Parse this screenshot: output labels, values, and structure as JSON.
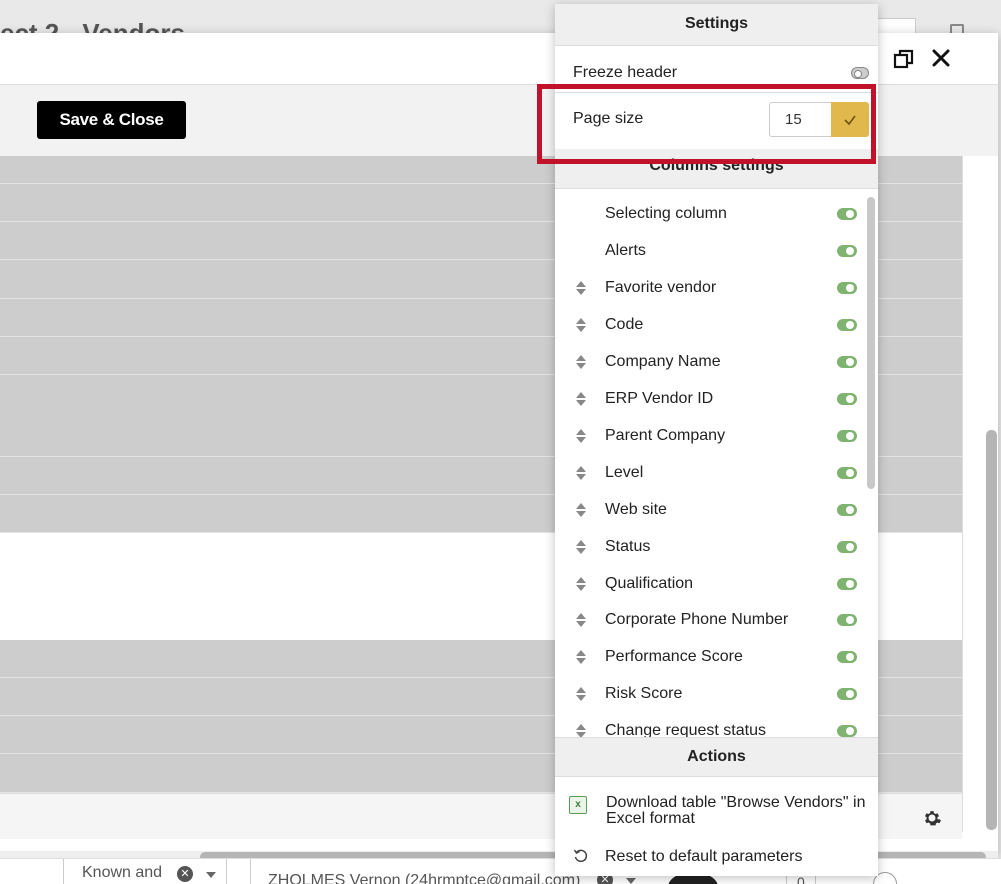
{
  "background": {
    "page_title": "ect 2 - Vendors"
  },
  "modal": {
    "save_close_label": "Save & Close",
    "restore_icon": "restore-window-icon",
    "close_icon": "close-icon",
    "settings_icon": "gear-icon"
  },
  "bottom_row": {
    "known_label": "Known and",
    "contact": "ZHOLMES Vernon (24hrmptce@gmail.com)",
    "number": "0"
  },
  "settings": {
    "title": "Settings",
    "freeze_header": "Freeze header",
    "freeze_header_on": false,
    "page_size_label": "Page size",
    "page_size_value": "15",
    "columns_title": "Columns settings",
    "columns": [
      {
        "label": "Selecting column",
        "sortable": false,
        "enabled": true
      },
      {
        "label": "Alerts",
        "sortable": false,
        "enabled": true
      },
      {
        "label": "Favorite vendor",
        "sortable": true,
        "enabled": true
      },
      {
        "label": "Code",
        "sortable": true,
        "enabled": true
      },
      {
        "label": "Company Name",
        "sortable": true,
        "enabled": true
      },
      {
        "label": "ERP Vendor ID",
        "sortable": true,
        "enabled": true
      },
      {
        "label": "Parent Company",
        "sortable": true,
        "enabled": true
      },
      {
        "label": "Level",
        "sortable": true,
        "enabled": true
      },
      {
        "label": "Web site",
        "sortable": true,
        "enabled": true
      },
      {
        "label": "Status",
        "sortable": true,
        "enabled": true
      },
      {
        "label": "Qualification",
        "sortable": true,
        "enabled": true
      },
      {
        "label": "Corporate Phone Number",
        "sortable": true,
        "enabled": true
      },
      {
        "label": "Performance Score",
        "sortable": true,
        "enabled": true
      },
      {
        "label": "Risk Score",
        "sortable": true,
        "enabled": true
      },
      {
        "label": "Change request status",
        "sortable": true,
        "enabled": true
      }
    ],
    "actions_title": "Actions",
    "download_excel": "Download table \"Browse Vendors\" in Excel format",
    "reset_defaults": "Reset to default parameters"
  },
  "colors": {
    "accent_yellow": "#e0b84b",
    "toggle_green": "#7fb370",
    "highlight_red": "#c0122a",
    "button_black": "#000000"
  }
}
